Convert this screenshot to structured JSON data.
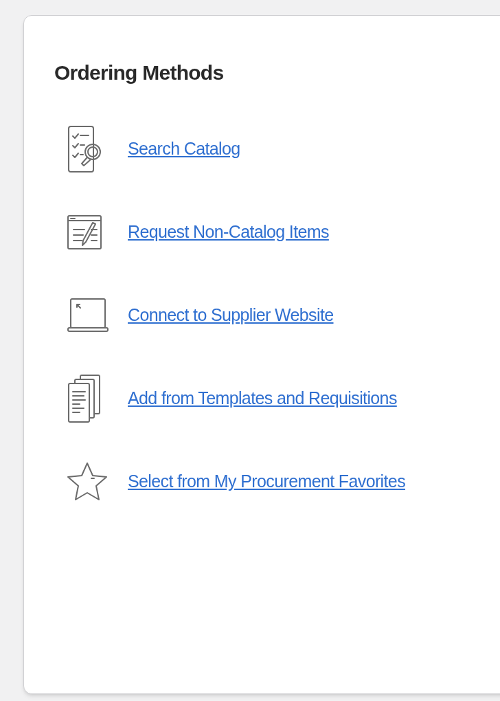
{
  "card": {
    "title": "Ordering Methods",
    "methods": [
      {
        "kind": "catalog",
        "label": "Search Catalog"
      },
      {
        "kind": "form",
        "label": "Request Non-Catalog Items"
      },
      {
        "kind": "laptop",
        "label": "Connect to Supplier Website"
      },
      {
        "kind": "documents",
        "label": "Add from Templates and Requisitions"
      },
      {
        "kind": "star",
        "label": "Select from My Procurement Favorites"
      }
    ]
  }
}
